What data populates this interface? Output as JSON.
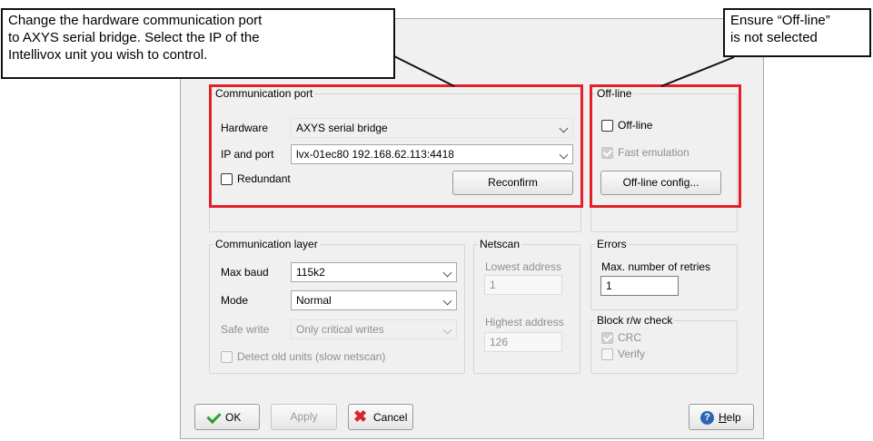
{
  "callouts": {
    "left": "Change the hardware communication port\nto AXYS serial bridge.  Select the IP of the\nIntellivox unit you wish to control.",
    "right": "Ensure “Off-line”\nis not selected"
  },
  "comm_port": {
    "legend": "Communication port",
    "hardware_label": "Hardware",
    "hardware_value": "AXYS serial bridge",
    "ip_label": "IP and port",
    "ip_value": "lvx-01ec80 192.168.62.113:4418",
    "redundant_label": "Redundant",
    "reconfirm_label": "Reconfirm"
  },
  "offline": {
    "legend": "Off-line",
    "offline_label": "Off-line",
    "fast_emulation_label": "Fast emulation",
    "config_label": "Off-line config..."
  },
  "comm_layer": {
    "legend": "Communication layer",
    "max_baud_label": "Max baud",
    "max_baud_value": "115k2",
    "mode_label": "Mode",
    "mode_value": "Normal",
    "safe_write_label": "Safe write",
    "safe_write_value": "Only critical writes",
    "detect_label": "Detect old units (slow netscan)"
  },
  "netscan": {
    "legend": "Netscan",
    "lowest_label": "Lowest address",
    "lowest_value": "1",
    "highest_label": "Highest address",
    "highest_value": "126"
  },
  "errors": {
    "legend": "Errors",
    "retries_label": "Max. number of retries",
    "retries_value": "1"
  },
  "block_check": {
    "legend": "Block r/w check",
    "crc_label": "CRC",
    "verify_label": "Verify"
  },
  "buttons": {
    "ok": "OK",
    "apply": "Apply",
    "cancel": "Cancel",
    "help_h": "H",
    "help_rest": "elp"
  },
  "colors": {
    "highlight": "#e3202a",
    "ok_icon": "#2f9e2f",
    "cancel_icon": "#d8262b",
    "help_icon": "#2c64b5"
  }
}
